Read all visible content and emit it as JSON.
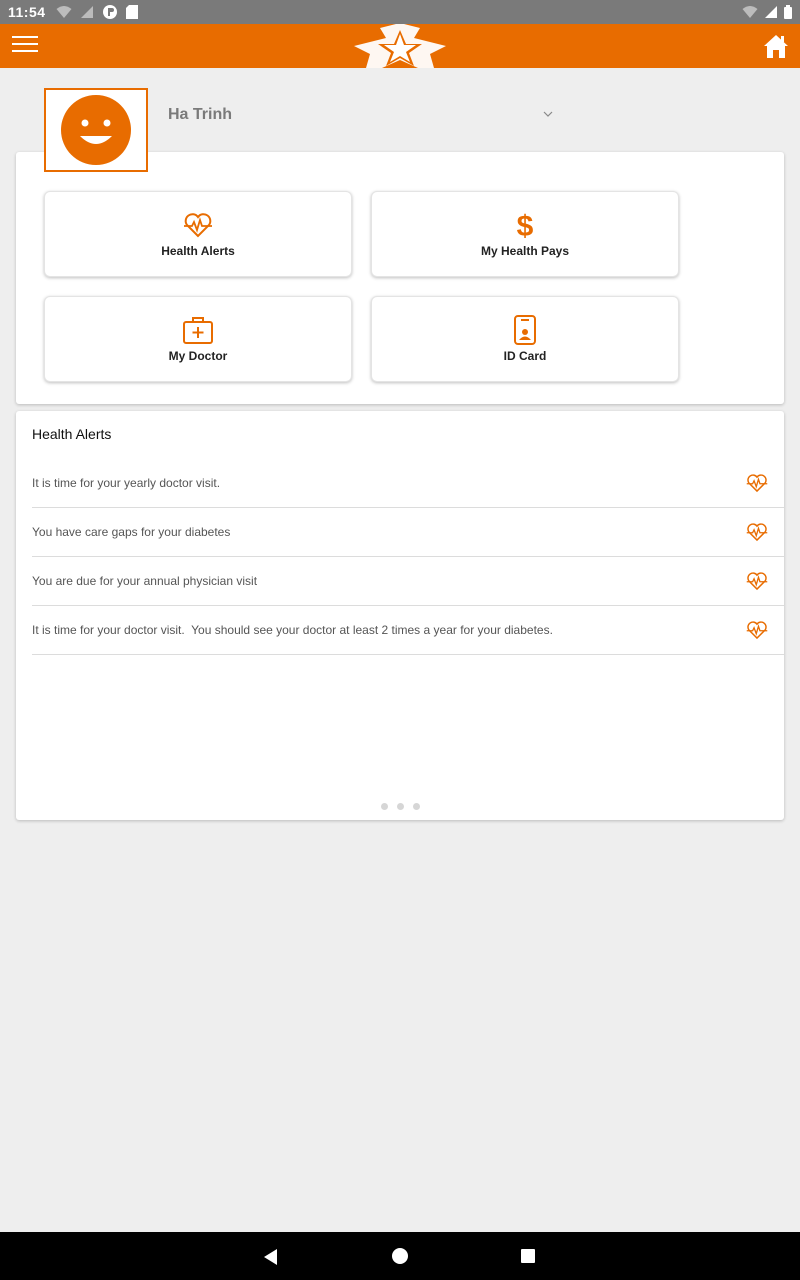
{
  "status_bar": {
    "time": "11:54"
  },
  "header": {
    "logo_icon": "star-logo-icon",
    "home_icon": "home-icon",
    "menu_icon": "hamburger-icon"
  },
  "profile": {
    "name": "Ha Trinh",
    "avatar_icon": "smiley-face-icon"
  },
  "tiles": [
    {
      "label": "Health Alerts",
      "icon": "heartbeat-icon"
    },
    {
      "label": "My Health Pays",
      "icon": "dollar-icon"
    },
    {
      "label": "My Doctor",
      "icon": "medical-kit-icon"
    },
    {
      "label": "ID Card",
      "icon": "id-card-icon"
    }
  ],
  "alerts": {
    "title": "Health Alerts",
    "items": [
      {
        "text": "It is time for your yearly doctor visit."
      },
      {
        "text": "You have care gaps for your diabetes"
      },
      {
        "text": "You are due for your annual physician visit"
      },
      {
        "text": "It is time for your doctor visit.  You should see your doctor at least 2 times a year for your diabetes."
      }
    ]
  },
  "colors": {
    "brand": "#e86c00",
    "status_bar": "#7a7a7a",
    "background": "#eeeeee"
  }
}
